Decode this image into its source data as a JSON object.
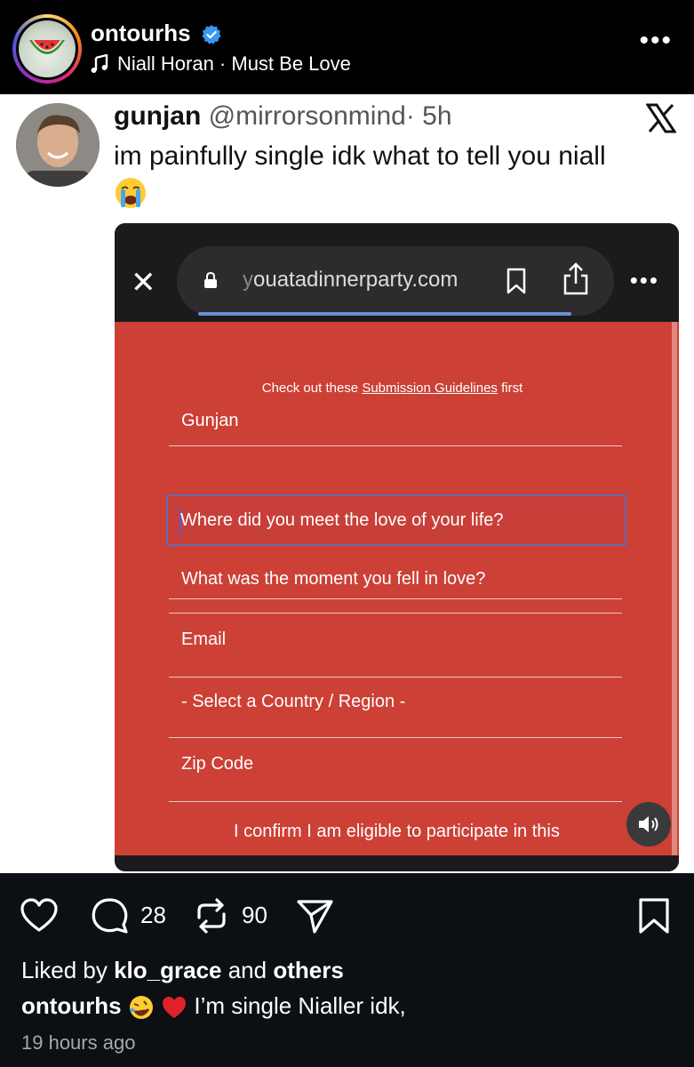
{
  "post": {
    "username": "ontourhs",
    "music": "Niall Horan · Must Be Love",
    "more": "•••"
  },
  "tweet": {
    "name": "gunjan",
    "handle": "@mirrorsonmind",
    "time": "· 5h",
    "text": "im painfully single idk what to tell you niall"
  },
  "browser": {
    "url_dim": "y",
    "url": "ouatadinnerparty.com",
    "more": "•••"
  },
  "form": {
    "guidelines_prefix": "Check out these ",
    "guidelines_link": "Submission Guidelines",
    "guidelines_suffix": " first",
    "fields": [
      "Gunjan",
      "Where did you meet the love of your life?",
      "What was the moment you fell in love?",
      "Email",
      "- Select a Country / Region -",
      "Zip Code"
    ],
    "confirm": "I confirm I am eligible to participate in this"
  },
  "actions": {
    "comments": "28",
    "reposts": "90"
  },
  "likes": {
    "prefix": "Liked by ",
    "user": "klo_grace",
    "middle": " and ",
    "others": "others"
  },
  "caption": {
    "user": "ontourhs",
    "text": "I’m single Nialler idk,"
  },
  "timestamp": "19 hours ago",
  "colors": {
    "form_bg": "#cc4036",
    "verified": "#3897f0",
    "focus_border": "#6b68b0"
  }
}
